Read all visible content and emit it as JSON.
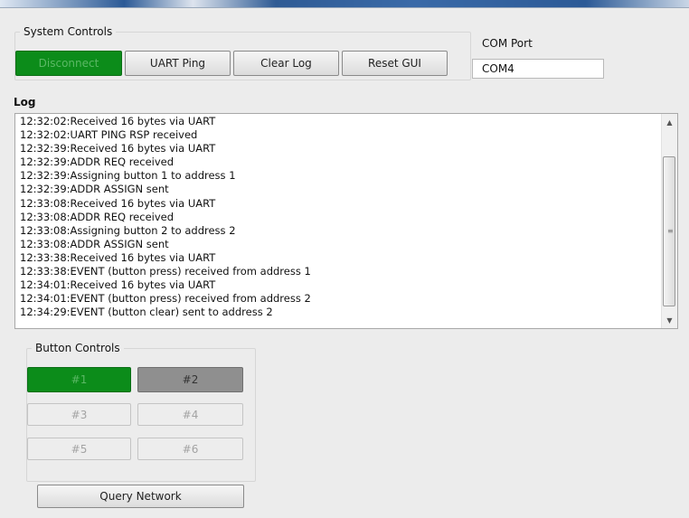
{
  "system_controls": {
    "title": "System Controls",
    "disconnect_label": "Disconnect",
    "uart_ping_label": "UART Ping",
    "clear_log_label": "Clear Log",
    "reset_gui_label": "Reset GUI"
  },
  "com_port": {
    "label": "COM Port",
    "value": "COM4"
  },
  "log": {
    "title": "Log",
    "lines": [
      "12:32:02:Received 16 bytes via UART",
      "12:32:02:UART PING RSP received",
      "12:32:39:Received 16 bytes via UART",
      "12:32:39:ADDR REQ received",
      "12:32:39:Assigning button 1 to address 1",
      "12:32:39:ADDR ASSIGN sent",
      "12:33:08:Received 16 bytes via UART",
      "12:33:08:ADDR REQ received",
      "12:33:08:Assigning button 2 to address 2",
      "12:33:08:ADDR ASSIGN sent",
      "12:33:38:Received 16 bytes via UART",
      "12:33:38:EVENT (button press) received from address 1",
      "12:34:01:Received 16 bytes via UART",
      "12:34:01:EVENT (button press) received from address 2",
      "12:34:29:EVENT (button clear) sent to address 2"
    ]
  },
  "button_controls": {
    "title": "Button Controls",
    "buttons": [
      "#1",
      "#2",
      "#3",
      "#4",
      "#5",
      "#6"
    ],
    "query_network_label": "Query Network"
  },
  "icons": {
    "scroll_up": "scroll-up-arrow-icon",
    "scroll_down": "scroll-down-arrow-icon",
    "scroll_grip": "scroll-grip-icon"
  },
  "colors": {
    "connected_green": "#0c8c1a",
    "active_gray": "#8f8f8f"
  }
}
